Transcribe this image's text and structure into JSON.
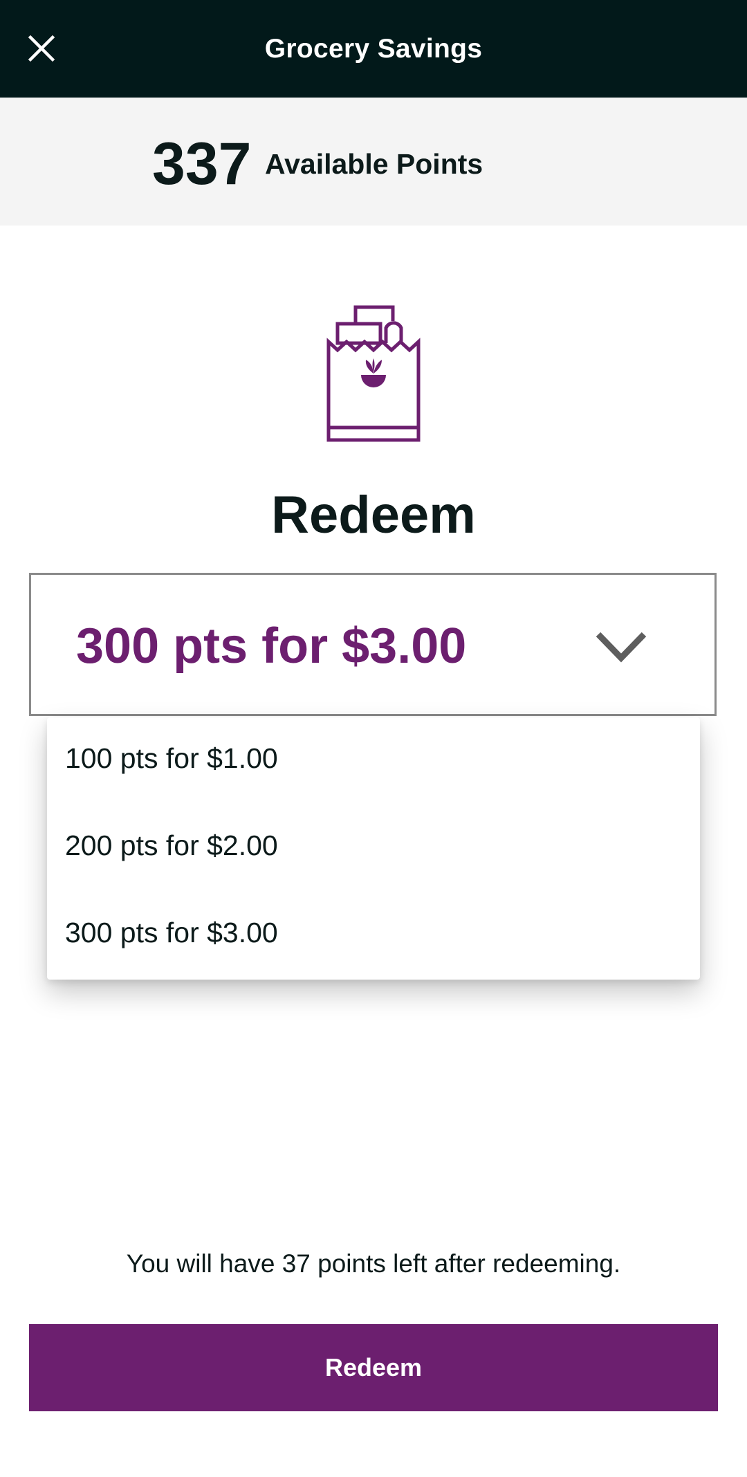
{
  "header": {
    "title": "Grocery Savings",
    "close_icon": "close-icon"
  },
  "points": {
    "value": "337",
    "label": "Available Points"
  },
  "hero": {
    "icon": "grocery-bag-icon",
    "heading": "Redeem"
  },
  "select": {
    "selected": "300 pts for $3.00",
    "icon": "chevron-down-icon",
    "options": [
      "100 pts for $1.00",
      "200 pts for $2.00",
      "300 pts for $3.00"
    ]
  },
  "footer": {
    "remaining_text": "You will have 37 points left after redeeming.",
    "button_label": "Redeem"
  },
  "colors": {
    "appbar_bg": "#02191a",
    "accent": "#6c1f6f",
    "band_bg": "#f4f4f4",
    "text": "#0c1a1a"
  }
}
